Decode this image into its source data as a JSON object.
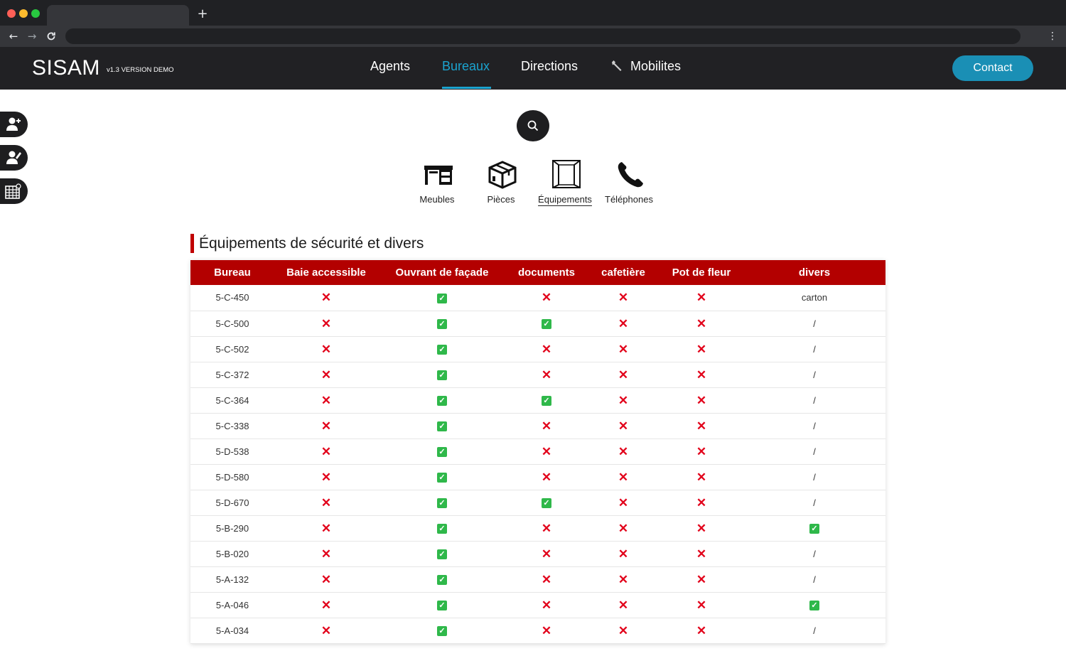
{
  "browser": {
    "new_tab_label": "+",
    "menu_glyph": "⋮"
  },
  "header": {
    "logo": "SISAM",
    "version": "v1.3 VERSION DEMO",
    "nav": [
      {
        "label": "Agents"
      },
      {
        "label": "Bureaux",
        "active": true
      },
      {
        "label": "Directions"
      },
      {
        "label": "Mobilites",
        "icon": "wrench-icon"
      }
    ],
    "contact_label": "Contact",
    "colors": {
      "accent": "#1ba3cf",
      "bar": "#212124"
    }
  },
  "sidebar": {
    "buttons": [
      {
        "icon": "add-user-icon"
      },
      {
        "icon": "edit-user-icon"
      },
      {
        "icon": "calendar-grid-icon"
      }
    ]
  },
  "search": {
    "icon": "search-icon"
  },
  "categories": [
    {
      "label": "Meubles",
      "icon": "desk-icon"
    },
    {
      "label": "Pièces",
      "icon": "box-icon"
    },
    {
      "label": "Équipements",
      "icon": "window-icon",
      "current": true
    },
    {
      "label": "Téléphones",
      "icon": "phone-icon"
    }
  ],
  "section_title": "Équipements de sécurité et divers",
  "table": {
    "header_color": "#b30000",
    "columns": [
      "Bureau",
      "Baie accessible",
      "Ouvrant de façade",
      "documents",
      "cafetière",
      "Pot de fleur",
      "divers"
    ],
    "rows": [
      {
        "bureau": "5-C-450",
        "baie": "no",
        "ouvrant": "yes",
        "documents": "no",
        "cafetiere": "no",
        "pot": "no",
        "divers": "carton"
      },
      {
        "bureau": "5-C-500",
        "baie": "no",
        "ouvrant": "yes",
        "documents": "yes",
        "cafetiere": "no",
        "pot": "no",
        "divers": "/"
      },
      {
        "bureau": "5-C-502",
        "baie": "no",
        "ouvrant": "yes",
        "documents": "no",
        "cafetiere": "no",
        "pot": "no",
        "divers": "/"
      },
      {
        "bureau": "5-C-372",
        "baie": "no",
        "ouvrant": "yes",
        "documents": "no",
        "cafetiere": "no",
        "pot": "no",
        "divers": "/"
      },
      {
        "bureau": "5-C-364",
        "baie": "no",
        "ouvrant": "yes",
        "documents": "yes",
        "cafetiere": "no",
        "pot": "no",
        "divers": "/"
      },
      {
        "bureau": "5-C-338",
        "baie": "no",
        "ouvrant": "yes",
        "documents": "no",
        "cafetiere": "no",
        "pot": "no",
        "divers": "/"
      },
      {
        "bureau": "5-D-538",
        "baie": "no",
        "ouvrant": "yes",
        "documents": "no",
        "cafetiere": "no",
        "pot": "no",
        "divers": "/"
      },
      {
        "bureau": "5-D-580",
        "baie": "no",
        "ouvrant": "yes",
        "documents": "no",
        "cafetiere": "no",
        "pot": "no",
        "divers": "/"
      },
      {
        "bureau": "5-D-670",
        "baie": "no",
        "ouvrant": "yes",
        "documents": "yes",
        "cafetiere": "no",
        "pot": "no",
        "divers": "/"
      },
      {
        "bureau": "5-B-290",
        "baie": "no",
        "ouvrant": "yes",
        "documents": "no",
        "cafetiere": "no",
        "pot": "no",
        "divers": "yes"
      },
      {
        "bureau": "5-B-020",
        "baie": "no",
        "ouvrant": "yes",
        "documents": "no",
        "cafetiere": "no",
        "pot": "no",
        "divers": "/"
      },
      {
        "bureau": "5-A-132",
        "baie": "no",
        "ouvrant": "yes",
        "documents": "no",
        "cafetiere": "no",
        "pot": "no",
        "divers": "/"
      },
      {
        "bureau": "5-A-046",
        "baie": "no",
        "ouvrant": "yes",
        "documents": "no",
        "cafetiere": "no",
        "pot": "no",
        "divers": "yes"
      },
      {
        "bureau": "5-A-034",
        "baie": "no",
        "ouvrant": "yes",
        "documents": "no",
        "cafetiere": "no",
        "pot": "no",
        "divers": "/"
      }
    ]
  }
}
